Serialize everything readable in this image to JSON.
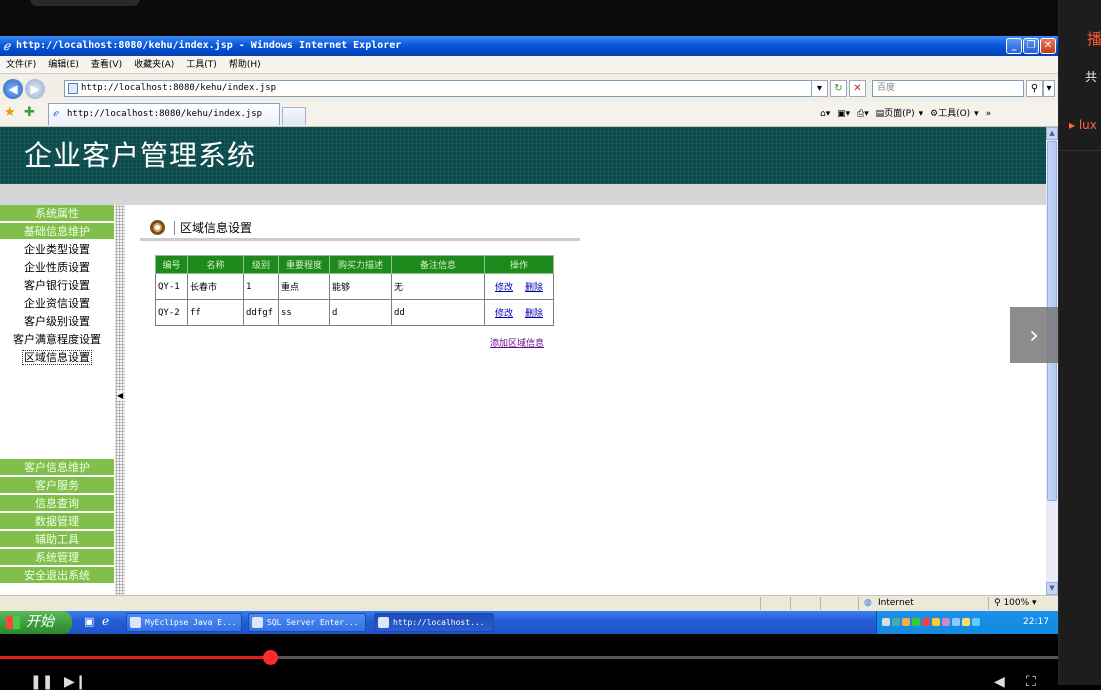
{
  "side_panel": {
    "title_char": "播",
    "count_char": "共",
    "item_text": "lux"
  },
  "window": {
    "title": "http://localhost:8080/kehu/index.jsp - Windows Internet Explorer",
    "buttons": [
      "_",
      "❐",
      "✕"
    ]
  },
  "menubar": [
    "文件(F)",
    "编辑(E)",
    "查看(V)",
    "收藏夹(A)",
    "工具(T)",
    "帮助(H)"
  ],
  "address": {
    "url": "http://localhost:8080/kehu/index.jsp",
    "search_placeholder": "百度"
  },
  "tab": {
    "label": "http://localhost:8080/kehu/index.jsp"
  },
  "commandbar": {
    "page": "页面(P)",
    "tools": "工具(O)"
  },
  "banner": {
    "title": "企业客户管理系统"
  },
  "nav": {
    "groups_top": [
      "系统属性",
      "基础信息维护"
    ],
    "sub_items": [
      "企业类型设置",
      "企业性质设置",
      "客户银行设置",
      "企业资信设置",
      "客户级别设置",
      "客户满意程度设置",
      "区域信息设置"
    ],
    "selected_index": 6,
    "groups_bottom": [
      "客户信息维护",
      "客户服务",
      "信息查询",
      "数据管理",
      "辅助工具",
      "系统管理",
      "安全退出系统"
    ]
  },
  "section": {
    "title": "区域信息设置"
  },
  "table": {
    "headers": [
      "编号",
      "名称",
      "级别",
      "重要程度",
      "购买力描述",
      "备注信息",
      "操作"
    ],
    "rows": [
      [
        "QY-1",
        "长春市",
        "1",
        "重点",
        "能够",
        "无"
      ],
      [
        "QY-2",
        "ff",
        "ddfgf",
        "ss",
        "d",
        "dd"
      ]
    ],
    "edit_label": "修改",
    "delete_label": "删除"
  },
  "add_link": "添加区域信息",
  "statusbar": {
    "zone": "Internet",
    "zoom": "100%"
  },
  "taskbar": {
    "start": "开始",
    "tasks": [
      "MyEclipse Java E...",
      "SQL Server Enter...",
      "http://localhost..."
    ],
    "clock": "22:17"
  },
  "player": {
    "progress": 0.255
  }
}
